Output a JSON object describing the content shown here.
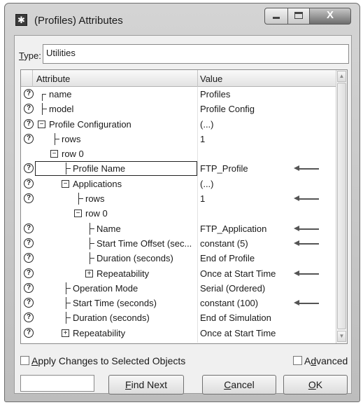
{
  "window": {
    "title": "(Profiles) Attributes",
    "app_icon": "asterisk-icon",
    "min_icon": "minimize-icon",
    "max_icon": "maximize-icon",
    "close_glyph": "X"
  },
  "type_field": {
    "label_first": "T",
    "label_rest": "ype:",
    "value": "Utilities"
  },
  "grid": {
    "headers": {
      "attribute": "Attribute",
      "value": "Value"
    },
    "rows": [
      {
        "help": "?",
        "name": "name",
        "value": "Profiles"
      },
      {
        "help": "?",
        "name": "model",
        "value": "Profile Config"
      },
      {
        "help": "?",
        "name": "Profile Configuration",
        "value": "(...)"
      },
      {
        "help": "?",
        "name": "rows",
        "value": "1"
      },
      {
        "help": "",
        "name": "row 0",
        "value": ""
      },
      {
        "help": "?",
        "name": "Profile Name",
        "value": "FTP_Profile"
      },
      {
        "help": "?",
        "name": "Applications",
        "value": "(...)"
      },
      {
        "help": "?",
        "name": "rows",
        "value": "1"
      },
      {
        "help": "",
        "name": "row 0",
        "value": ""
      },
      {
        "help": "?",
        "name": "Name",
        "value": "FTP_Application"
      },
      {
        "help": "?",
        "name": "Start Time Offset (sec...",
        "value": "constant (5)"
      },
      {
        "help": "?",
        "name": "Duration (seconds)",
        "value": "End of Profile"
      },
      {
        "help": "?",
        "name": "Repeatability",
        "value": "Once at Start Time"
      },
      {
        "help": "?",
        "name": "Operation Mode",
        "value": "Serial (Ordered)"
      },
      {
        "help": "?",
        "name": "Start Time (seconds)",
        "value": "constant (100)"
      },
      {
        "help": "?",
        "name": "Duration (seconds)",
        "value": "End of Simulation"
      },
      {
        "help": "?",
        "name": "Repeatability",
        "value": "Once at Start Time"
      }
    ],
    "expand_minus": "−",
    "expand_plus": "+",
    "scroll_up": "▲",
    "scroll_down": "▼"
  },
  "apply_changes": {
    "first": "A",
    "rest": "pply Changes to Selected Objects"
  },
  "advanced": {
    "pre": "A",
    "u": "d",
    "post": "vanced"
  },
  "buttons": {
    "find_next": {
      "u": "F",
      "rest": "ind Next"
    },
    "cancel": {
      "u": "C",
      "rest": "ancel"
    },
    "ok": {
      "u": "O",
      "rest": "K"
    }
  },
  "colors": {
    "window_frame": "#c8c8c8",
    "grid_bg": "#ffffff",
    "arrow": "#555555"
  }
}
